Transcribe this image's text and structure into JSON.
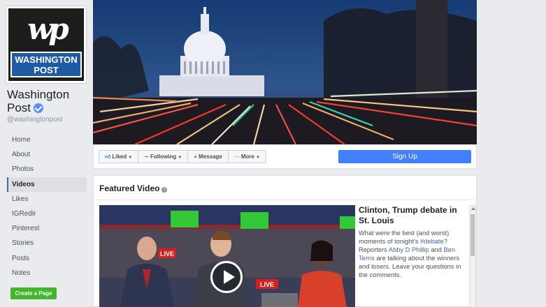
{
  "page": {
    "logo_text": "WASHINGTON POST",
    "logo_mark": "wp",
    "name": "Washington Post",
    "handle": "@washingtonpost",
    "verified_icon": "verified-badge-icon"
  },
  "nav": {
    "items": [
      {
        "label": "Home"
      },
      {
        "label": "About"
      },
      {
        "label": "Photos"
      },
      {
        "label": "Videos",
        "active": true
      },
      {
        "label": "Likes"
      },
      {
        "label": "IGRedir"
      },
      {
        "label": "Pinterest"
      },
      {
        "label": "Stories"
      },
      {
        "label": "Posts"
      },
      {
        "label": "Notes"
      }
    ],
    "create_page": "Create a Page"
  },
  "actions": {
    "liked": "Liked",
    "following": "Following",
    "message": "Message",
    "more": "More",
    "sign_up": "Sign Up"
  },
  "featured": {
    "title": "Featured Video",
    "video": {
      "title": "Clinton, Trump debate in St. Louis",
      "desc_1": "What were the best (and worst) moments of tonight's ",
      "hashtag": "#debate",
      "desc_2": "? Reporters ",
      "person_1": "Abby D Phillip",
      "desc_3": " and ",
      "person_2": "Ben Terris",
      "desc_4": " are talking about the winners and losers. Leave your questions in the comments.",
      "live_badge": "LIVE"
    }
  },
  "colors": {
    "brand_blue": "#4267b2",
    "signup_blue": "#4080ff",
    "create_green": "#42b72a",
    "logo_blue": "#1f5aa6"
  }
}
